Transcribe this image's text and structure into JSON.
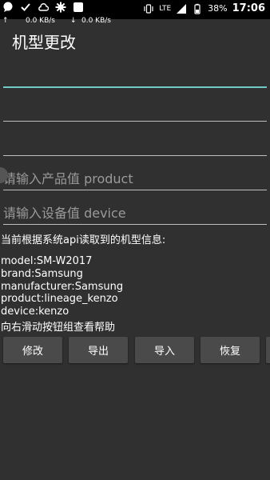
{
  "status_bar": {
    "lte": "LTE",
    "battery": "38%",
    "time": "17:06"
  },
  "net_speed": {
    "up": "0.0 KB/s",
    "down": "0.0 KB/s"
  },
  "header": {
    "title": "机型更改"
  },
  "fields": [
    {
      "value": "",
      "placeholder": ""
    },
    {
      "value": "",
      "placeholder": ""
    },
    {
      "value": "",
      "placeholder": ""
    },
    {
      "value": "",
      "placeholder": "请输入产品值 product"
    },
    {
      "value": "",
      "placeholder": "请输入设备值 device"
    }
  ],
  "info": {
    "heading": "当前根据系统api读取到的机型信息:",
    "model": "model:SM-W2017",
    "brand": "brand:Samsung",
    "manufacturer": "manufacturer:Samsung",
    "product": "product:lineage_kenzo",
    "device": "device:kenzo",
    "hint": "向右滑动按钮组查看帮助"
  },
  "buttons": {
    "modify": "修改",
    "export": "导出",
    "import": "导入",
    "restore": "恢复"
  }
}
